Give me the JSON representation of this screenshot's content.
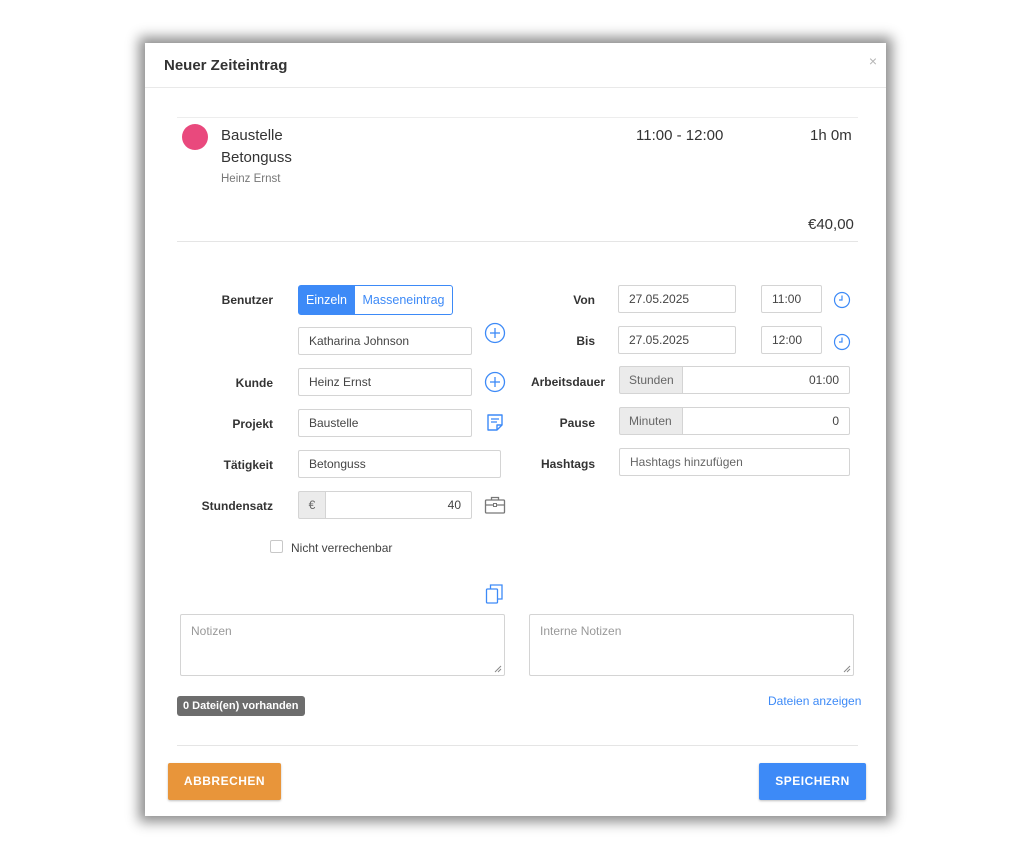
{
  "dialog": {
    "title": "Neuer Zeiteintrag",
    "close_label": "×"
  },
  "summary": {
    "project": "Baustelle",
    "task": "Betonguss",
    "client": "Heinz Ernst",
    "time_range": "11:00 - 12:00",
    "duration": "1h 0m",
    "amount": "€40,00",
    "dot_color": "#e9497d"
  },
  "form": {
    "user_label": "Benutzer",
    "mode_single": "Einzeln",
    "mode_bulk": "Masseneintrag",
    "user_value": "Katharina Johnson",
    "client_label": "Kunde",
    "client_value": "Heinz Ernst",
    "project_label": "Projekt",
    "project_value": "Baustelle",
    "activity_label": "Tätigkeit",
    "activity_value": "Betonguss",
    "rate_label": "Stundensatz",
    "rate_currency": "€",
    "rate_value": "40",
    "not_billable_label": "Nicht verrechenbar",
    "not_billable_checked": false,
    "from_label": "Von",
    "from_date": "27.05.2025",
    "from_time": "11:00",
    "to_label": "Bis",
    "to_date": "27.05.2025",
    "to_time": "12:00",
    "duration_label": "Arbeitsdauer",
    "duration_unit": "Stunden",
    "duration_value": "01:00",
    "pause_label": "Pause",
    "pause_unit": "Minuten",
    "pause_value": "0",
    "hashtags_label": "Hashtags",
    "hashtags_placeholder": "Hashtags hinzufügen",
    "notes_placeholder": "Notizen",
    "internal_notes_placeholder": "Interne Notizen"
  },
  "files": {
    "badge": "0 Datei(en) vorhanden",
    "show_link": "Dateien anzeigen"
  },
  "actions": {
    "cancel": "ABBRECHEN",
    "save": "SPEICHERN"
  },
  "colors": {
    "primary": "#3d8af7",
    "cancel": "#e8953a",
    "badge": "#6d6d6d"
  },
  "icons": {
    "add_user": "plus-circle-icon",
    "add_client": "plus-circle-icon",
    "project_note": "note-icon",
    "rate_briefcase": "briefcase-icon",
    "from_clock": "clock-icon",
    "to_clock": "clock-icon",
    "copy_notes": "copy-icon"
  }
}
